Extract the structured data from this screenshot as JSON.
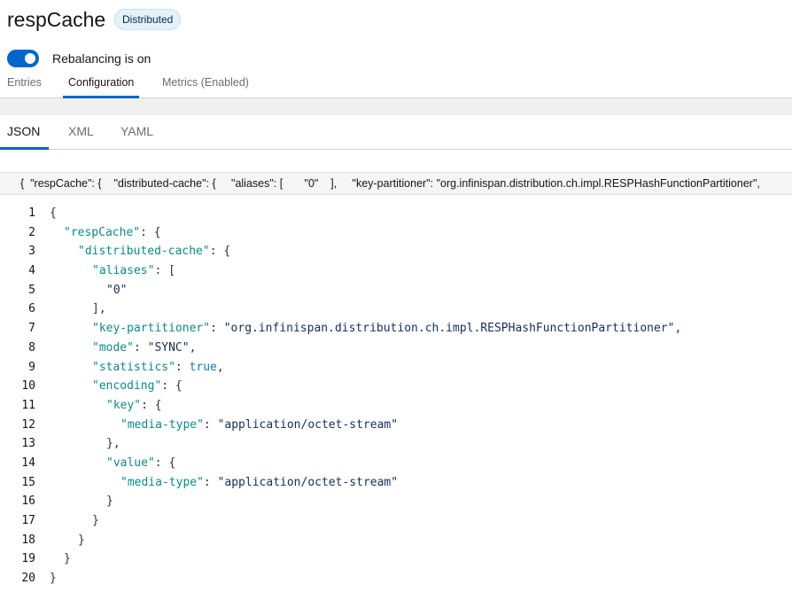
{
  "header": {
    "title": "respCache",
    "badge": "Distributed"
  },
  "rebalancing": {
    "label": "Rebalancing is on",
    "enabled": true
  },
  "tabs": [
    {
      "label": "Entries"
    },
    {
      "label": "Configuration",
      "active": true
    },
    {
      "label": "Metrics (Enabled)"
    }
  ],
  "format_tabs": [
    {
      "label": "JSON",
      "active": true
    },
    {
      "label": "XML"
    },
    {
      "label": "YAML"
    }
  ],
  "flat_json": "{  \"respCache\": {    \"distributed-cache\": {     \"aliases\": [       \"0\"    ],     \"key-partitioner\": \"org.infinispan.distribution.ch.impl.RESPHashFunctionPartitioner\",",
  "code_lines": [
    {
      "n": "1",
      "indent": 0,
      "tokens": [
        {
          "t": "p",
          "v": "{"
        }
      ]
    },
    {
      "n": "2",
      "indent": 1,
      "tokens": [
        {
          "t": "k",
          "v": "\"respCache\""
        },
        {
          "t": "p",
          "v": ": {"
        }
      ]
    },
    {
      "n": "3",
      "indent": 2,
      "tokens": [
        {
          "t": "k",
          "v": "\"distributed-cache\""
        },
        {
          "t": "p",
          "v": ": {"
        }
      ]
    },
    {
      "n": "4",
      "indent": 3,
      "tokens": [
        {
          "t": "k",
          "v": "\"aliases\""
        },
        {
          "t": "p",
          "v": ": ["
        }
      ]
    },
    {
      "n": "5",
      "indent": 4,
      "tokens": [
        {
          "t": "s",
          "v": "\"0\""
        }
      ]
    },
    {
      "n": "6",
      "indent": 3,
      "tokens": [
        {
          "t": "p",
          "v": "],"
        }
      ]
    },
    {
      "n": "7",
      "indent": 3,
      "tokens": [
        {
          "t": "k",
          "v": "\"key-partitioner\""
        },
        {
          "t": "p",
          "v": ": "
        },
        {
          "t": "s",
          "v": "\"org.infinispan.distribution.ch.impl.RESPHashFunctionPartitioner\""
        },
        {
          "t": "p",
          "v": ","
        }
      ]
    },
    {
      "n": "8",
      "indent": 3,
      "tokens": [
        {
          "t": "k",
          "v": "\"mode\""
        },
        {
          "t": "p",
          "v": ": "
        },
        {
          "t": "s",
          "v": "\"SYNC\""
        },
        {
          "t": "p",
          "v": ","
        }
      ]
    },
    {
      "n": "9",
      "indent": 3,
      "tokens": [
        {
          "t": "k",
          "v": "\"statistics\""
        },
        {
          "t": "p",
          "v": ": "
        },
        {
          "t": "b",
          "v": "true"
        },
        {
          "t": "p",
          "v": ","
        }
      ]
    },
    {
      "n": "10",
      "indent": 3,
      "tokens": [
        {
          "t": "k",
          "v": "\"encoding\""
        },
        {
          "t": "p",
          "v": ": {"
        }
      ]
    },
    {
      "n": "11",
      "indent": 4,
      "tokens": [
        {
          "t": "k",
          "v": "\"key\""
        },
        {
          "t": "p",
          "v": ": {"
        }
      ]
    },
    {
      "n": "12",
      "indent": 5,
      "tokens": [
        {
          "t": "k",
          "v": "\"media-type\""
        },
        {
          "t": "p",
          "v": ": "
        },
        {
          "t": "s",
          "v": "\"application/octet-stream\""
        }
      ]
    },
    {
      "n": "13",
      "indent": 4,
      "tokens": [
        {
          "t": "p",
          "v": "},"
        }
      ]
    },
    {
      "n": "14",
      "indent": 4,
      "tokens": [
        {
          "t": "k",
          "v": "\"value\""
        },
        {
          "t": "p",
          "v": ": {"
        }
      ]
    },
    {
      "n": "15",
      "indent": 5,
      "tokens": [
        {
          "t": "k",
          "v": "\"media-type\""
        },
        {
          "t": "p",
          "v": ": "
        },
        {
          "t": "s",
          "v": "\"application/octet-stream\""
        }
      ]
    },
    {
      "n": "16",
      "indent": 4,
      "tokens": [
        {
          "t": "p",
          "v": "}"
        }
      ]
    },
    {
      "n": "17",
      "indent": 3,
      "tokens": [
        {
          "t": "p",
          "v": "}"
        }
      ]
    },
    {
      "n": "18",
      "indent": 2,
      "tokens": [
        {
          "t": "p",
          "v": "}"
        }
      ]
    },
    {
      "n": "19",
      "indent": 1,
      "tokens": [
        {
          "t": "p",
          "v": "}"
        }
      ]
    },
    {
      "n": "20",
      "indent": 0,
      "tokens": [
        {
          "t": "p",
          "v": "}"
        }
      ]
    }
  ],
  "colors": {
    "accent": "#0066cc",
    "json_key": "#0b8a8a",
    "json_string": "#152e5c",
    "json_boolean": "#0b7bb8"
  }
}
